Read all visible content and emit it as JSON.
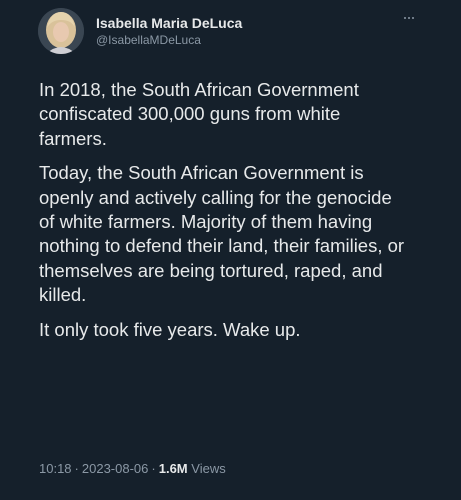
{
  "author": {
    "display_name": "Isabella Maria DeLuca",
    "handle": "@IsabellaMDeLuca"
  },
  "menu": {
    "more_icon": "more-horizontal-icon"
  },
  "tweet": {
    "paragraphs": [
      "In 2018, the South African Government confiscated 300,000 guns from white farmers.",
      "Today, the South African Government is openly and actively calling for the genocide of white farmers. Majority of them having nothing to defend their land, their families, or themselves are being tortured, raped, and killed.",
      "It only took five years. Wake up."
    ]
  },
  "meta": {
    "time": "10:18",
    "separator": "·",
    "date": "2023-08-06",
    "views_count": "1.6M",
    "views_label": "Views"
  },
  "colors": {
    "background": "#15202b",
    "text_primary": "#e7e9ea",
    "text_secondary": "#8b98a5"
  }
}
